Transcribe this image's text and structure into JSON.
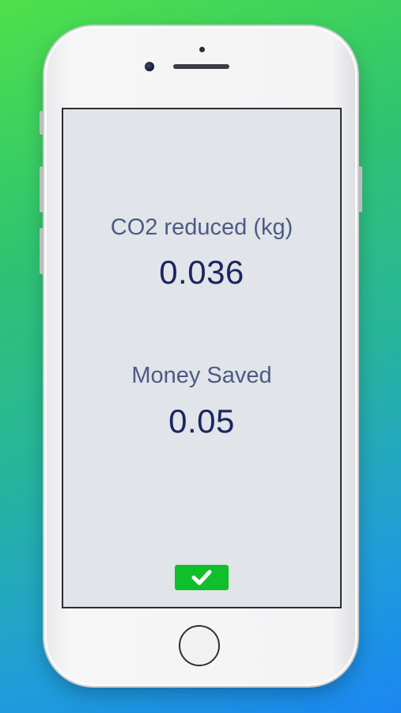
{
  "screen": {
    "co2": {
      "label": "CO2 reduced (kg)",
      "value": "0.036"
    },
    "money": {
      "label": "Money Saved",
      "value": "0.05"
    },
    "confirm_icon": "checkmark-icon"
  },
  "colors": {
    "accent_green": "#0fbf2b",
    "value_text": "#1a2562",
    "label_text": "#4c5a86",
    "screen_bg": "#e1e4e8"
  }
}
